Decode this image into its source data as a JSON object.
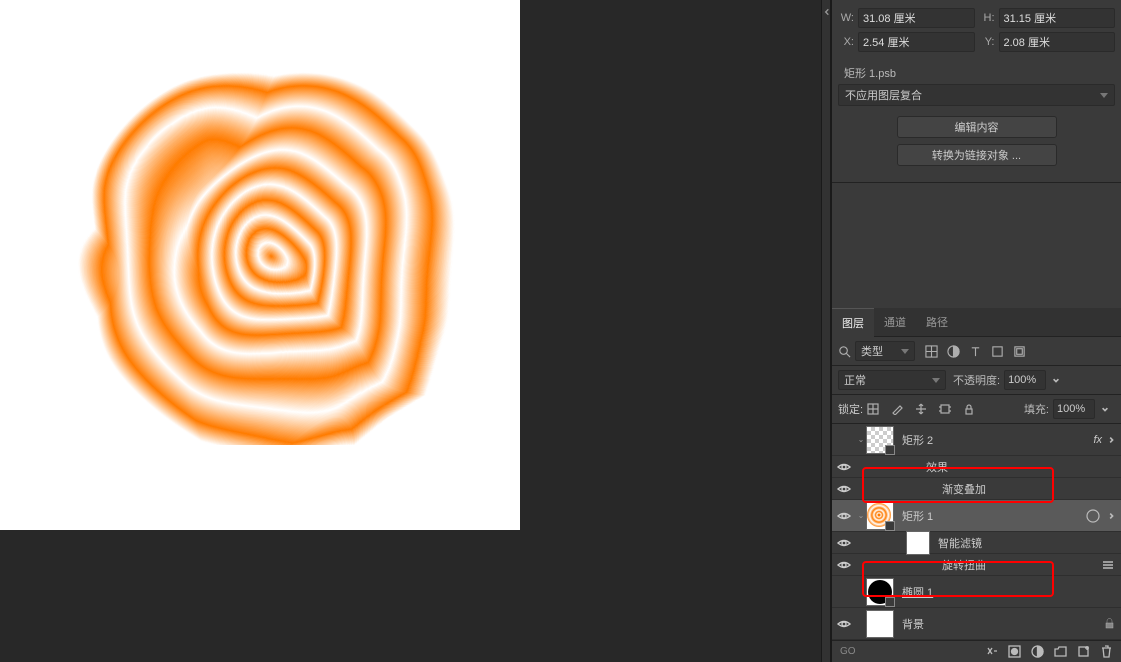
{
  "props": {
    "w_label": "W:",
    "w_value": "31.08 厘米",
    "h_label": "H:",
    "h_value": "31.15 厘米",
    "x_label": "X:",
    "x_value": "2.54 厘米",
    "y_label": "Y:",
    "y_value": "2.08 厘米",
    "filename": "矩形 1.psb",
    "combo_placeholder": "不应用图层复合",
    "edit_btn": "编辑内容",
    "convert_btn": "转换为链接对象 ..."
  },
  "panel_tabs": {
    "layers": "图层",
    "channels": "通道",
    "paths": "路径"
  },
  "filter": {
    "kind_label": "类型"
  },
  "blend": {
    "mode": "正常",
    "opacity_label": "不透明度:",
    "opacity_value": "100%"
  },
  "lock": {
    "label": "锁定:",
    "fill_label": "填充:",
    "fill_value": "100%"
  },
  "layers": {
    "rect2": "矩形 2",
    "fx_label": "效果",
    "gradient_overlay": "渐变叠加",
    "rect1": "矩形 1",
    "smart_filters": "智能滤镜",
    "twirl": "旋转扭曲",
    "ellipse1": "椭圆 1",
    "background": "背景"
  },
  "icons": {
    "link": "GO"
  }
}
